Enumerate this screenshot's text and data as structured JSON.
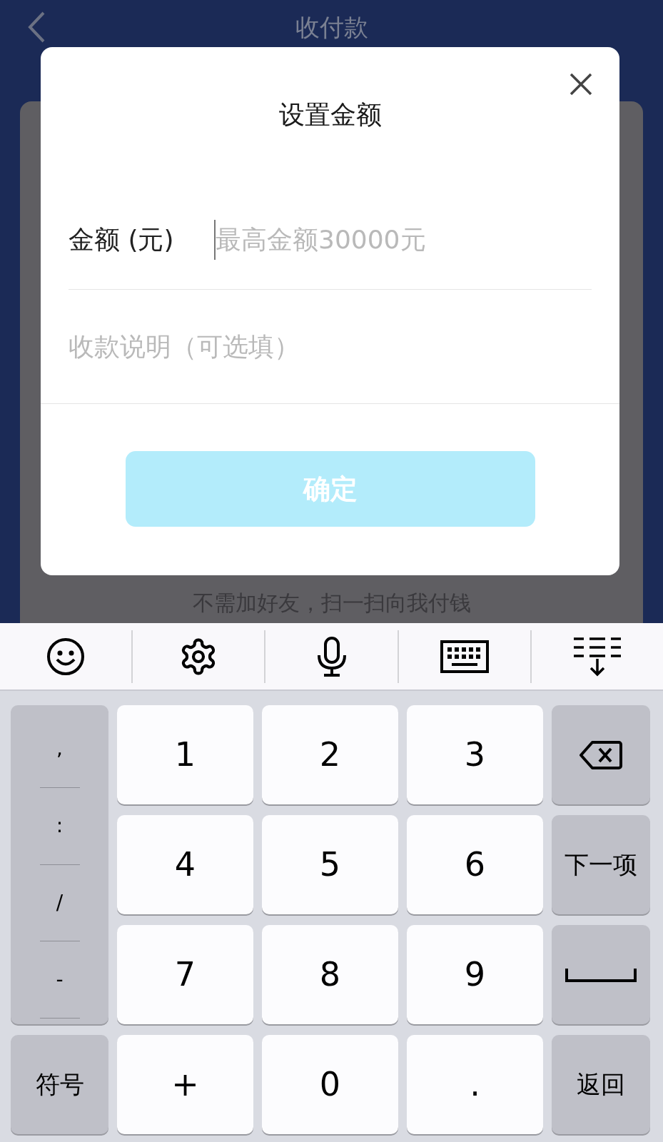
{
  "header": {
    "title": "收付款"
  },
  "caption": "不需加好友，扫一扫向我付钱",
  "dialog": {
    "title": "设置金额",
    "amount": {
      "label": "金额 (元)",
      "placeholder": "最高金额30000元",
      "focused": true
    },
    "note": {
      "placeholder": "收款说明（可选填）"
    },
    "confirm": {
      "label": "确定",
      "disabled": true
    }
  },
  "keyboard": {
    "symbols": [
      ",",
      ":",
      "/",
      "-"
    ],
    "keys": [
      {
        "kind": "digit",
        "label": "1"
      },
      {
        "kind": "digit",
        "label": "2"
      },
      {
        "kind": "digit",
        "label": "3"
      },
      {
        "kind": "backspace"
      },
      {
        "kind": "digit",
        "label": "4"
      },
      {
        "kind": "digit",
        "label": "5"
      },
      {
        "kind": "digit",
        "label": "6"
      },
      {
        "kind": "function",
        "label": "下一项"
      },
      {
        "kind": "digit",
        "label": "7"
      },
      {
        "kind": "digit",
        "label": "8"
      },
      {
        "kind": "digit",
        "label": "9"
      },
      {
        "kind": "space"
      },
      {
        "kind": "function",
        "label": "符号"
      },
      {
        "kind": "digit",
        "label": "+"
      },
      {
        "kind": "digit",
        "label": "0"
      },
      {
        "kind": "digit",
        "label": "."
      },
      {
        "kind": "function",
        "label": "返回"
      }
    ]
  }
}
